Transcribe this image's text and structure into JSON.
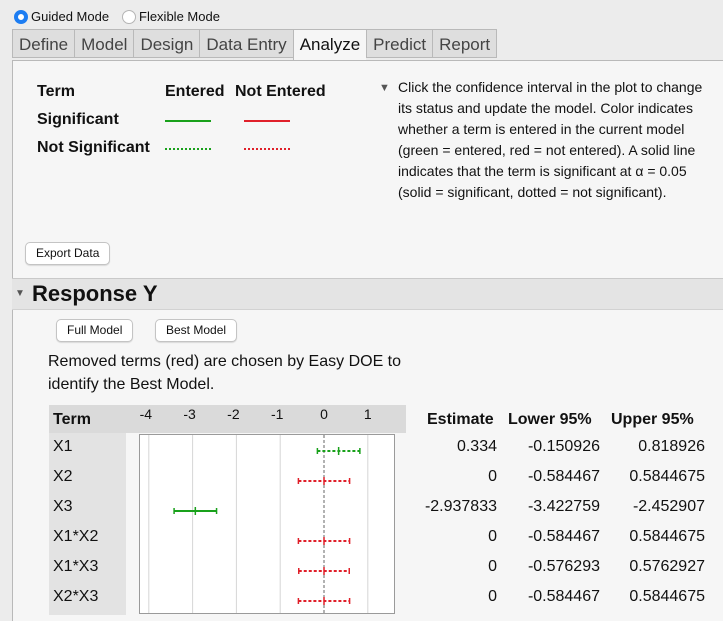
{
  "mode": {
    "options": [
      {
        "label": "Guided Mode",
        "selected": true
      },
      {
        "label": "Flexible Mode",
        "selected": false
      }
    ]
  },
  "tabs": [
    {
      "label": "Define",
      "active": false
    },
    {
      "label": "Model",
      "active": false
    },
    {
      "label": "Design",
      "active": false
    },
    {
      "label": "Data Entry",
      "active": false
    },
    {
      "label": "Analyze",
      "active": true
    },
    {
      "label": "Predict",
      "active": false
    },
    {
      "label": "Report",
      "active": false
    }
  ],
  "legend": {
    "term_header": "Term",
    "entered_header": "Entered",
    "not_entered_header": "Not Entered",
    "significant": "Significant",
    "not_significant": "Not Significant"
  },
  "help_text": "Click the confidence interval in the plot to change its status and update the model. Color indicates whether a term is entered in the current model (green = entered, red = not entered). A solid line indicates that the term is significant at α = 0.05 (solid = significant, dotted = not significant).",
  "export_button": "Export Data",
  "response": {
    "title": "Response Y",
    "full_model_button": "Full Model",
    "best_model_button": "Best Model",
    "note": "Removed terms (red)  are chosen by Easy DOE to identify the Best Model."
  },
  "table": {
    "headers": {
      "term": "Term",
      "estimate": "Estimate",
      "lower": "Lower 95%",
      "upper": "Upper 95%"
    },
    "axis_ticks": [
      "-4",
      "-3",
      "-2",
      "-1",
      "0",
      "1"
    ],
    "rows": [
      {
        "term": "X1",
        "estimate": "0.334",
        "lower": "-0.150926",
        "upper": "0.818926",
        "entered": true,
        "significant": false
      },
      {
        "term": "X2",
        "estimate": "0",
        "lower": "-0.584467",
        "upper": "0.5844675",
        "entered": false,
        "significant": false
      },
      {
        "term": "X3",
        "estimate": "-2.937833",
        "lower": "-3.422759",
        "upper": "-2.452907",
        "entered": true,
        "significant": true
      },
      {
        "term": "X1*X2",
        "estimate": "0",
        "lower": "-0.584467",
        "upper": "0.5844675",
        "entered": false,
        "significant": false
      },
      {
        "term": "X1*X3",
        "estimate": "0",
        "lower": "-0.576293",
        "upper": "0.5762927",
        "entered": false,
        "significant": false
      },
      {
        "term": "X2*X3",
        "estimate": "0",
        "lower": "-0.584467",
        "upper": "0.5844675",
        "entered": false,
        "significant": false
      }
    ]
  },
  "colors": {
    "entered": "#19a11b",
    "not_entered": "#e0202a",
    "accent": "#1d7df2"
  }
}
